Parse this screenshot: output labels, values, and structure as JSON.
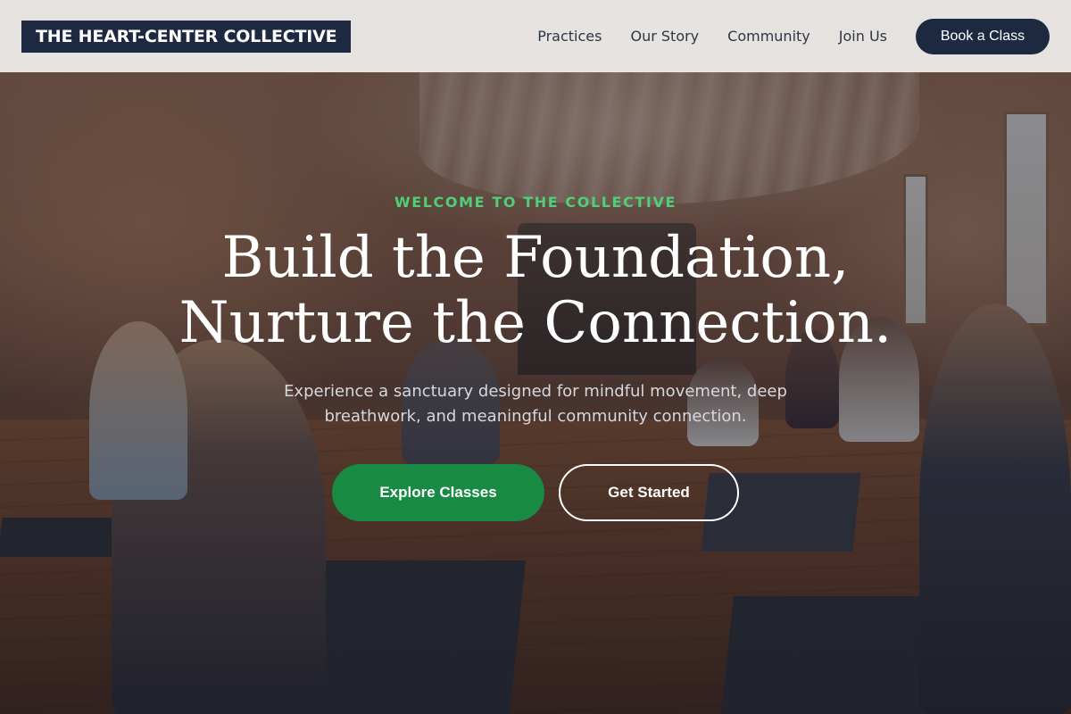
{
  "header": {
    "logo_text": "THE HEART-CENTER COLLECTIVE",
    "nav_items": [
      {
        "label": "Practices"
      },
      {
        "label": "Our Story"
      },
      {
        "label": "Community"
      },
      {
        "label": "Join Us"
      }
    ],
    "cta_label": "Book a Class"
  },
  "hero": {
    "eyebrow": "WELCOME TO THE COLLECTIVE",
    "headline_line1": "Build the Foundation,",
    "headline_line2": "Nurture the Connection.",
    "subtext": "Experience a sanctuary designed for mindful movement, deep breathwork, and meaningful community connection.",
    "primary_button": "Explore Classes",
    "secondary_button": "Get Started",
    "background_image": "yoga-studio-class-photo"
  },
  "colors": {
    "brand_navy": "#1c2940",
    "accent_green": "#198a44",
    "eyebrow_green": "#4fcf76",
    "header_bg": "#eeecea"
  }
}
